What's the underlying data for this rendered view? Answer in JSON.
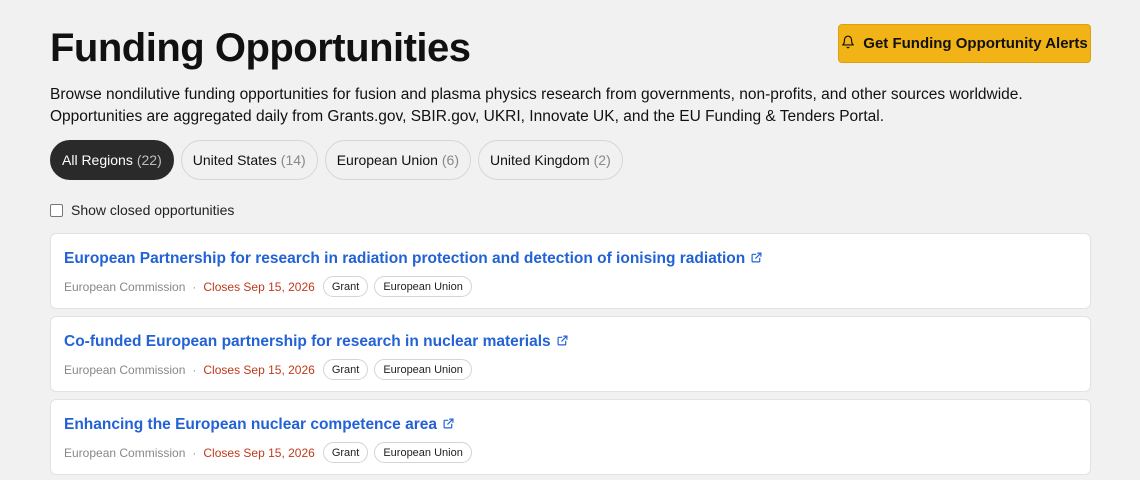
{
  "header": {
    "title": "Funding Opportunities",
    "alert_button_label": "Get Funding Opportunity Alerts",
    "description": "Browse nondilutive funding opportunities for fusion and plasma physics research from governments, non-profits, and other sources worldwide. Opportunities are aggregated daily from Grants.gov, SBIR.gov, UKRI, Innovate UK, and the EU Funding & Tenders Portal."
  },
  "filters": [
    {
      "label": "All Regions",
      "count": "(22)",
      "active": true
    },
    {
      "label": "United States",
      "count": "(14)",
      "active": false
    },
    {
      "label": "European Union",
      "count": "(6)",
      "active": false
    },
    {
      "label": "United Kingdom",
      "count": "(2)",
      "active": false
    }
  ],
  "show_closed": {
    "label": "Show closed opportunities",
    "checked": false
  },
  "opportunities": [
    {
      "title": "European Partnership for research in radiation protection and detection of ionising radiation",
      "agency": "European Commission",
      "closes": "Closes Sep 15, 2026",
      "type": "Grant",
      "region": "European Union"
    },
    {
      "title": "Co-funded European partnership for research in nuclear materials",
      "agency": "European Commission",
      "closes": "Closes Sep 15, 2026",
      "type": "Grant",
      "region": "European Union"
    },
    {
      "title": "Enhancing the European nuclear competence area",
      "agency": "European Commission",
      "closes": "Closes Sep 15, 2026",
      "type": "Grant",
      "region": "European Union"
    }
  ],
  "colors": {
    "accent": "#f2b316",
    "link": "#2262d6",
    "closes": "#c0391b",
    "active_pill": "#2a2a2a"
  },
  "icons": {
    "alert": "bell-icon",
    "title_link": "external-link-icon"
  }
}
